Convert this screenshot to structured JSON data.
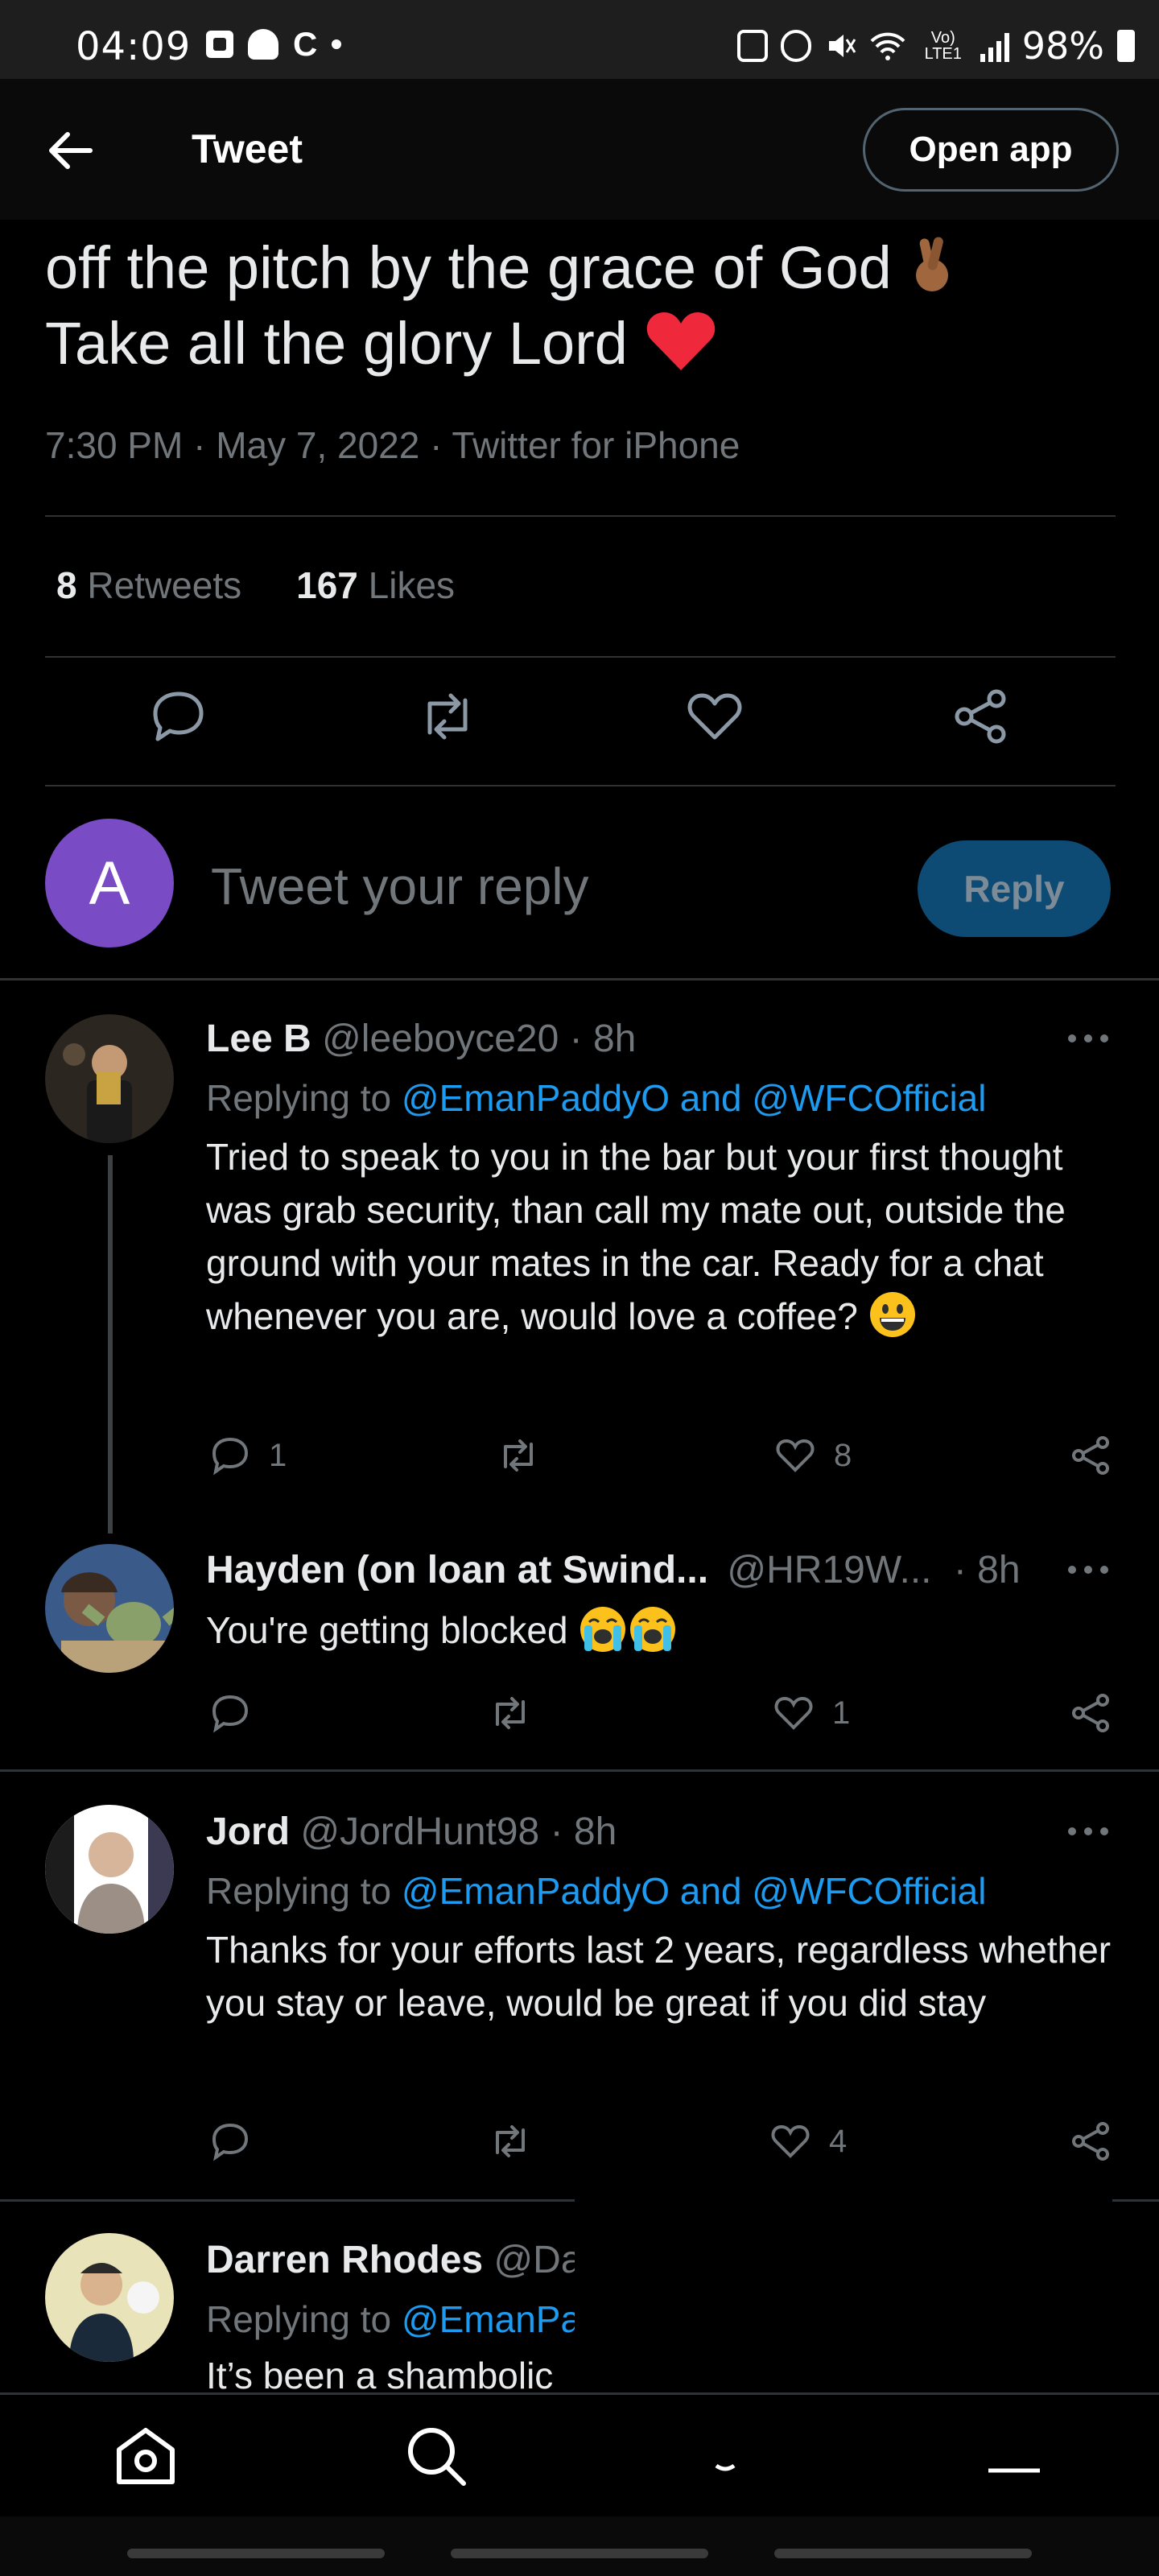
{
  "status_bar": {
    "time": "04:09",
    "left_icons": [
      "notification-square-icon",
      "snapchat-icon",
      "c-icon",
      "dot-icon"
    ],
    "network": "Vo) LTE1",
    "battery": "98%"
  },
  "header": {
    "title": "Tweet",
    "open_app": "Open app"
  },
  "tweet": {
    "line1": "off the pitch by the grace of God",
    "line2": "Take all the glory Lord",
    "meta": "7:30 PM · May 7, 2022 · Twitter for iPhone",
    "retweets_count": "8",
    "retweets_label": "Retweets",
    "likes_count": "167",
    "likes_label": "Likes"
  },
  "composer": {
    "avatar_letter": "A",
    "placeholder": "Tweet your reply",
    "reply_button": "Reply"
  },
  "replies": [
    {
      "name": "Lee B",
      "handle_time": "@leeboyce20 · 8h",
      "replying_prefix": "Replying to",
      "replying_to": "@EmanPaddyO and @WFCOfficial",
      "text": "Tried to speak to you in the bar but your first thought was grab security, than call my mate out, outside the ground with your mates in the car. Ready for a chat whenever you are, would love a coffee?",
      "reply_count": "1",
      "retweet_count": "",
      "like_count": "8"
    },
    {
      "name": "Hayden (on loan at Swind...",
      "handle": "@HR19W...",
      "time": "· 8h",
      "text": "You're getting blocked",
      "reply_count": "",
      "retweet_count": "",
      "like_count": "1"
    },
    {
      "name": "Jord",
      "handle_time": "@JordHunt98 · 8h",
      "replying_prefix": "Replying to",
      "replying_to": "@EmanPaddyO and @WFCOfficial",
      "text": "Thanks for your efforts last 2 years, regardless whether you stay or leave, would be great if you did stay",
      "reply_count": "",
      "retweet_count": "",
      "like_count": "4"
    },
    {
      "name": "Darren Rhodes",
      "handle_partial": "@Da",
      "replying_prefix": "Replying to",
      "replying_partial": "@EmanPa",
      "text_partial": "It’s been a shambolic"
    }
  ],
  "colors": {
    "background": "#000000",
    "link": "#1d9bf0",
    "muted": "#71767b",
    "composer_avatar": "#794bc4",
    "reply_button": "#0d4a74"
  }
}
